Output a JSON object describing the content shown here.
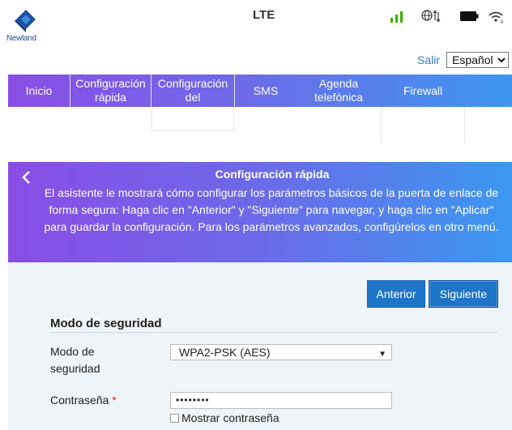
{
  "brand": {
    "name": "Newland"
  },
  "status": {
    "network": "LTE",
    "network_faded": "",
    "signal_color": "#38b000",
    "battery_color": "#111111"
  },
  "top": {
    "logout": "Salir",
    "language": "Español"
  },
  "nav": {
    "items": [
      {
        "id": "inicio",
        "label": "Inicio"
      },
      {
        "id": "config-rapida",
        "label": "Configuración rápida"
      },
      {
        "id": "config-dispositivo",
        "label": "Configuración del"
      },
      {
        "id": "sms",
        "label": "SMS"
      },
      {
        "id": "agenda",
        "label": "Agenda telefónica"
      },
      {
        "id": "firewall",
        "label": "Firewall"
      }
    ]
  },
  "banner": {
    "title": "Configuración rápida",
    "description": "El asistente le mostrará cómo configurar los parámetros básicos de la puerta de enlace de forma segura: Haga clic en \"Anterior\" y \"Siguiente\" para navegar, y haga clic en \"Aplicar\" para guardar la configuración. Para los parámetros avanzados, configúrelos en otro menú."
  },
  "wizard": {
    "prev_label": "Anterior",
    "next_label": "Siguiente",
    "section_title": "Modo de seguridad",
    "security_mode_label": "Modo de seguridad",
    "security_mode_value": "WPA2-PSK (AES)",
    "password_label": "Contraseña",
    "password_required_mark": "*",
    "password_value": "••••••••",
    "show_password_label": "Mostrar contraseña"
  },
  "colors": {
    "accent": "#1e75c8",
    "gradient_start": "#8a4de6",
    "gradient_end": "#3b98f0",
    "panel_bg": "#eff4f8"
  }
}
